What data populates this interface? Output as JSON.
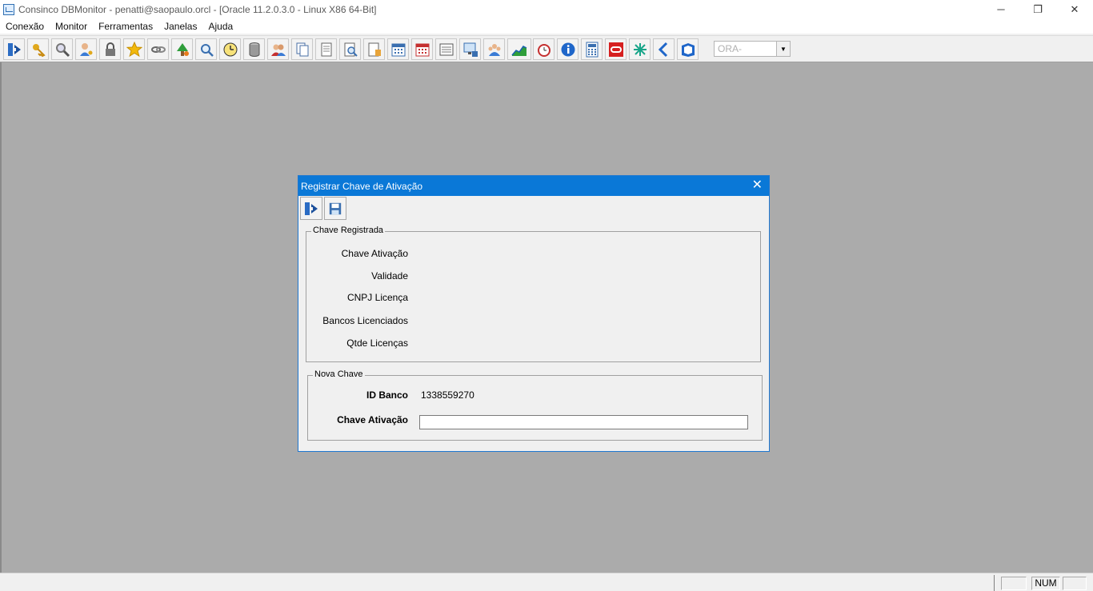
{
  "window": {
    "title": "Consinco DBMonitor - penatti@saopaulo.orcl - [Oracle 11.2.0.3.0 - Linux X86 64-Bit]",
    "controls": {
      "minimize": "─",
      "restore": "❐",
      "close": "✕"
    }
  },
  "menu": {
    "items": [
      "Conexão",
      "Monitor",
      "Ferramentas",
      "Janelas",
      "Ajuda"
    ]
  },
  "toolbar": {
    "icons": [
      "exit-icon",
      "key-icon",
      "magnifier-icon",
      "user-key-icon",
      "padlock-icon",
      "star-icon",
      "chain-icon",
      "tree-icon",
      "search-sql-icon",
      "clock-icon",
      "database-icon",
      "users-icon",
      "copy-icon",
      "document-icon",
      "document-search-icon",
      "document-note-icon",
      "calendar-blue-icon",
      "calendar-red-icon",
      "list-icon",
      "monitor-icon",
      "group-icon",
      "chart-icon",
      "alarm-clock-icon",
      "info-icon",
      "calculator-icon",
      "oracle-icon",
      "asterisk-icon",
      "back-arrow-icon",
      "book-icon"
    ],
    "instance_combo": {
      "value": "ORA-"
    }
  },
  "dialog": {
    "title": "Registrar Chave de Ativação",
    "close_glyph": "✕",
    "registered": {
      "legend": "Chave Registrada",
      "labels": {
        "chave": "Chave Ativação",
        "validade": "Validade",
        "cnpj": "CNPJ Licença",
        "bancos": "Bancos Licenciados",
        "qtde": "Qtde Licenças"
      }
    },
    "new_key": {
      "legend": "Nova Chave",
      "id_banco_label": "ID Banco",
      "id_banco_value": "1338559270",
      "chave_label": "Chave Ativação",
      "chave_value": ""
    }
  },
  "statusbar": {
    "num": "NUM"
  }
}
